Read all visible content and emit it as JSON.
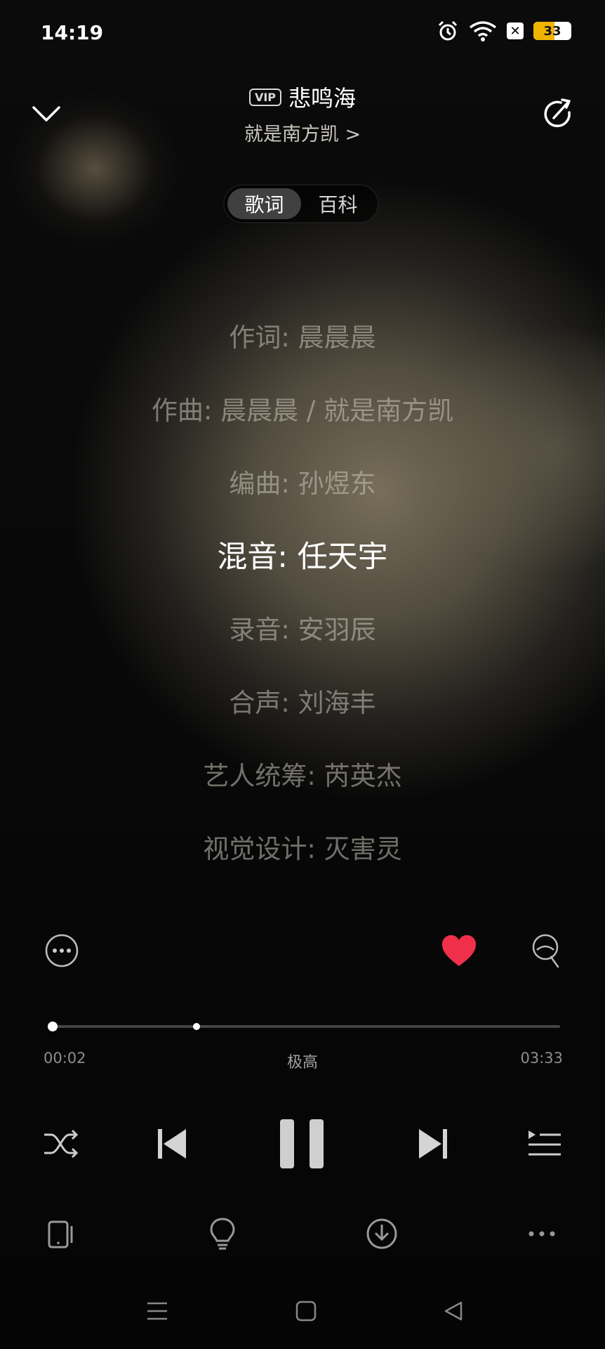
{
  "status_bar": {
    "time": "14:19",
    "battery": "33",
    "icons": [
      "alarm-icon",
      "wifi-icon",
      "sim-x-icon",
      "battery-icon"
    ]
  },
  "header": {
    "vip_badge": "VIP",
    "song_title": "悲鸣海",
    "artist": "就是南方凯 >"
  },
  "tabs": [
    {
      "label": "歌词",
      "active": true
    },
    {
      "label": "百科",
      "active": false
    }
  ],
  "lyrics": [
    {
      "text": "作词: 晨晨晨",
      "current": false
    },
    {
      "text": "作曲: 晨晨晨 / 就是南方凯",
      "current": false
    },
    {
      "text": "编曲: 孙煜东",
      "current": false
    },
    {
      "text": "混音: 任天宇",
      "current": true
    },
    {
      "text": "录音: 安羽辰",
      "current": false
    },
    {
      "text": "合声: 刘海丰",
      "current": false
    },
    {
      "text": "艺人统筹: 芮英杰",
      "current": false
    },
    {
      "text": "视觉设计: 灭害灵",
      "current": false
    }
  ],
  "actions": {
    "liked": true,
    "like_color": "#f0304a"
  },
  "progress": {
    "elapsed": "00:02",
    "total": "03:33",
    "quality": "极高",
    "played_fraction": 0.01,
    "buffered_fraction": 0.29
  },
  "controls": [
    "shuffle-icon",
    "previous-icon",
    "pause-icon",
    "next-icon",
    "playlist-icon"
  ],
  "bottom_tools": [
    "device-icon",
    "lightbulb-icon",
    "download-icon",
    "more-dots-icon"
  ],
  "nav_bar": [
    "menu-icon",
    "home-icon",
    "back-icon"
  ]
}
